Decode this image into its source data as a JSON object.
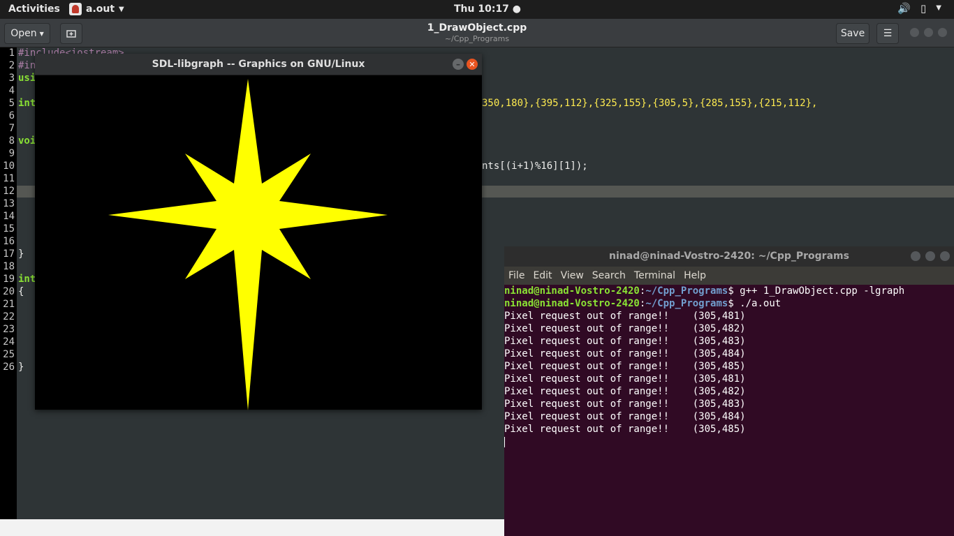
{
  "topbar": {
    "activities": "Activities",
    "app_name": "a.out",
    "clock": "Thu 10:17 ●"
  },
  "header": {
    "open_label": "Open",
    "title": "1_DrawObject.cpp",
    "subtitle": "~/Cpp_Programs",
    "save_label": "Save"
  },
  "editor": {
    "line_numbers": [
      "1",
      "2",
      "3",
      "4",
      "5",
      "6",
      "7",
      "8",
      "9",
      "10",
      "11",
      "12",
      "13",
      "14",
      "15",
      "16",
      "17",
      "18",
      "19",
      "20",
      "21",
      "22",
      "23",
      "24",
      "25",
      "26"
    ],
    "visible_code": {
      "line1": "#include<iostream>",
      "line2": "#in",
      "line3": "usi",
      "line5_left": "int",
      "line5_right": "350,180},{395,112},{325,155},{305,5},{285,155},{215,112},",
      "line8": "voi",
      "line10_right": "nts[(i+1)%16][1]);",
      "line17": "}",
      "line19": "int",
      "line20": "{",
      "line26": "}"
    }
  },
  "sdl_window": {
    "title": "SDL-libgraph -- Graphics on GNU/Linux",
    "star_color": "#ffff00"
  },
  "terminal": {
    "title": "ninad@ninad-Vostro-2420: ~/Cpp_Programs",
    "menu": [
      "File",
      "Edit",
      "View",
      "Search",
      "Terminal",
      "Help"
    ],
    "prompt_user": "ninad@ninad-Vostro-2420",
    "prompt_dir": "~/Cpp_Programs",
    "cmd1": "$ g++ 1_DrawObject.cpp -lgraph",
    "cmd2": "$ ./a.out",
    "out1": "Pixel request out of range!!    (305,481)",
    "out2": "Pixel request out of range!!    (305,482)",
    "out3": "Pixel request out of range!!    (305,483)",
    "out4": "Pixel request out of range!!    (305,484)",
    "out5": "Pixel request out of range!!    (305,485)",
    "out6": "Pixel request out of range!!    (305,481)",
    "out7": "Pixel request out of range!!    (305,482)",
    "out8": "Pixel request out of range!!    (305,483)",
    "out9": "Pixel request out of range!!    (305,484)",
    "out10": "Pixel request out of range!!    (305,485)"
  }
}
